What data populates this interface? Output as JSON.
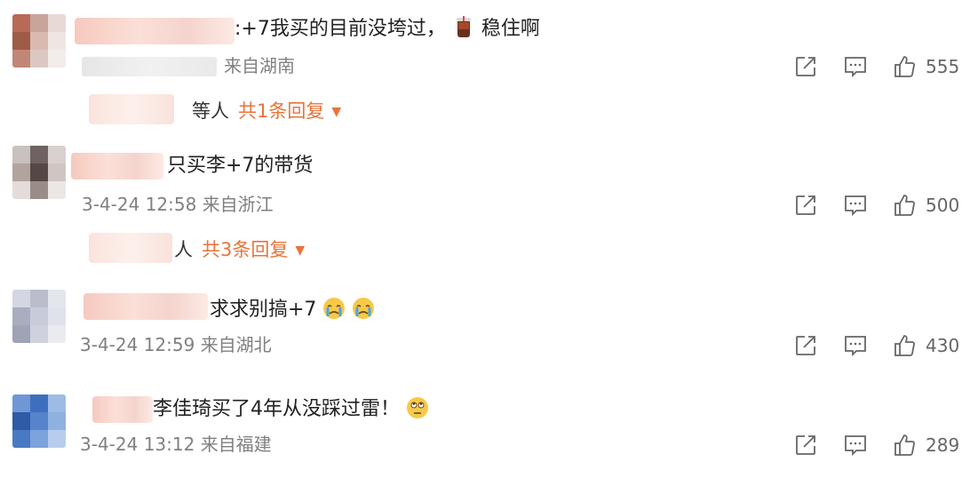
{
  "comments": [
    {
      "text": ":+7我买的目前没垮过，",
      "text_after_emoji": "稳住啊",
      "emoji": "drink-emoji",
      "meta_time": "",
      "meta_location": "来自湖南",
      "likes": "555",
      "reply": {
        "who_suffix": "等人",
        "count_label": "共1条回复"
      },
      "avatar_colors": [
        "#b86a57",
        "#c9a49a",
        "#e7d9d5",
        "#a05a48",
        "#d9b9b0",
        "#efe6e3",
        "#c08677",
        "#dcc8c3",
        "#f2ecea"
      ]
    },
    {
      "text": "只买李+7的带货",
      "meta_time": "3-4-24 12:58",
      "meta_location": "来自浙江",
      "likes": "500",
      "reply": {
        "who_suffix": "人",
        "count_label": "共3条回复"
      },
      "avatar_colors": [
        "#c9c1bd",
        "#6f6260",
        "#d8d1ce",
        "#b3a39e",
        "#544845",
        "#cfc6c3",
        "#e3dcda",
        "#9a8c88",
        "#ece7e5"
      ]
    },
    {
      "text": "求求别搞+7",
      "emoji": "crying-emoji",
      "meta_time": "3-4-24 12:59",
      "meta_location": "来自湖北",
      "likes": "430",
      "avatar_colors": [
        "#d4d7e2",
        "#b9bdcc",
        "#e4e6ee",
        "#a9adbf",
        "#c8ccd9",
        "#dfe2ea",
        "#9ea3b6",
        "#cfd2dd",
        "#e9ebf1"
      ]
    },
    {
      "text": "李佳琦买了4年从没踩过雷！",
      "emoji": "eye-roll-emoji",
      "meta_time": "3-4-24 13:12",
      "meta_location": "来自福建",
      "likes": "289",
      "avatar_colors": [
        "#6f97d6",
        "#3e6fbf",
        "#9dbbe6",
        "#2f5aa6",
        "#5683cc",
        "#8fb1e0",
        "#4a79c4",
        "#7ca3da",
        "#b7cdee"
      ]
    }
  ],
  "icons": {
    "share": "share-icon",
    "comment": "comment-icon",
    "like": "like-icon"
  },
  "colors": {
    "reply_accent": "#e8743b",
    "meta_gray": "#808080"
  }
}
